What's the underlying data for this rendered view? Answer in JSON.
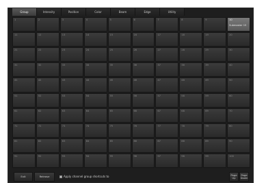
{
  "tabs": [
    "Group",
    "Intensity",
    "Position",
    "Color",
    "Beam",
    "Edge",
    "Utility"
  ],
  "active_tab": 0,
  "grid": {
    "cells": [
      {
        "num": "1"
      },
      {
        "num": "2"
      },
      {
        "num": "3"
      },
      {
        "num": "4"
      },
      {
        "num": "5"
      },
      {
        "num": "6"
      },
      {
        "num": "7"
      },
      {
        "num": "8"
      },
      {
        "num": "9"
      },
      {
        "num": "10",
        "label": "Submaster 15",
        "highlighted": true
      },
      {
        "num": "11"
      },
      {
        "num": "12"
      },
      {
        "num": "13"
      },
      {
        "num": "14"
      },
      {
        "num": "15"
      },
      {
        "num": "16"
      },
      {
        "num": "17"
      },
      {
        "num": "18"
      },
      {
        "num": "19"
      },
      {
        "num": "20"
      },
      {
        "num": "21"
      },
      {
        "num": "22"
      },
      {
        "num": "23"
      },
      {
        "num": "24"
      },
      {
        "num": "25"
      },
      {
        "num": "26"
      },
      {
        "num": "27"
      },
      {
        "num": "28"
      },
      {
        "num": "29"
      },
      {
        "num": "30"
      },
      {
        "num": "31"
      },
      {
        "num": "32"
      },
      {
        "num": "33"
      },
      {
        "num": "34"
      },
      {
        "num": "35"
      },
      {
        "num": "36"
      },
      {
        "num": "37"
      },
      {
        "num": "38"
      },
      {
        "num": "39"
      },
      {
        "num": "40"
      },
      {
        "num": "41"
      },
      {
        "num": "42"
      },
      {
        "num": "43"
      },
      {
        "num": "44"
      },
      {
        "num": "45"
      },
      {
        "num": "46"
      },
      {
        "num": "47"
      },
      {
        "num": "48"
      },
      {
        "num": "49"
      },
      {
        "num": "50"
      },
      {
        "num": "51"
      },
      {
        "num": "52"
      },
      {
        "num": "53"
      },
      {
        "num": "54"
      },
      {
        "num": "55"
      },
      {
        "num": "56"
      },
      {
        "num": "57"
      },
      {
        "num": "58"
      },
      {
        "num": "59"
      },
      {
        "num": "60"
      },
      {
        "num": "61"
      },
      {
        "num": "62"
      },
      {
        "num": "63"
      },
      {
        "num": "64"
      },
      {
        "num": "65"
      },
      {
        "num": "66"
      },
      {
        "num": "67"
      },
      {
        "num": "68"
      },
      {
        "num": "69"
      },
      {
        "num": "70"
      },
      {
        "num": "71"
      },
      {
        "num": "72"
      },
      {
        "num": "73"
      },
      {
        "num": "74"
      },
      {
        "num": "75"
      },
      {
        "num": "76"
      },
      {
        "num": "77"
      },
      {
        "num": "78"
      },
      {
        "num": "79"
      },
      {
        "num": "80"
      },
      {
        "num": "81"
      },
      {
        "num": "82"
      },
      {
        "num": "83"
      },
      {
        "num": "84"
      },
      {
        "num": "85"
      },
      {
        "num": "86"
      },
      {
        "num": "87"
      },
      {
        "num": "88"
      },
      {
        "num": "89"
      },
      {
        "num": "90"
      },
      {
        "num": "91"
      },
      {
        "num": "92"
      },
      {
        "num": "93"
      },
      {
        "num": "94"
      },
      {
        "num": "95"
      },
      {
        "num": "96"
      },
      {
        "num": "97"
      },
      {
        "num": "98"
      },
      {
        "num": "99"
      },
      {
        "num": "100"
      }
    ]
  },
  "footer": {
    "exit_label": "Exit",
    "release_label": "Release",
    "apply_checked": true,
    "apply_label": "Apply channel group shortcuts to",
    "page_up_label": "Page Up",
    "page_down_label": "Page Down"
  },
  "colors": {
    "background": "#1e1e1e",
    "cell": "#333333",
    "cell_highlight": "#6a6a6a",
    "text": "#cfcfcf"
  }
}
